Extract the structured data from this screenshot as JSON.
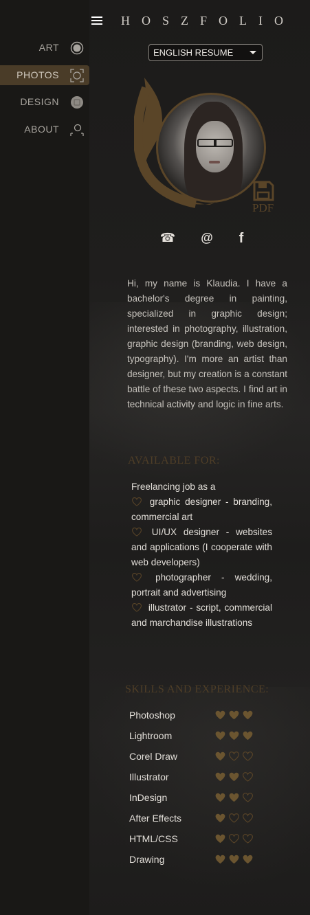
{
  "brand": "HOSZFOLIO",
  "nav": [
    {
      "label": "ART",
      "icon": "art-circle-icon",
      "active": false
    },
    {
      "label": "PHOTOS",
      "icon": "camera-focus-icon",
      "active": true
    },
    {
      "label": "DESIGN",
      "icon": "design-icon",
      "active": false
    },
    {
      "label": "ABOUT",
      "icon": "person-icon",
      "active": false
    }
  ],
  "language_select": {
    "value": "ENGLISH RESUME"
  },
  "pdf": {
    "label": "PDF",
    "icon": "save-icon"
  },
  "contacts": {
    "phone": "☎",
    "email": "@",
    "facebook": "f"
  },
  "bio": "Hi, my name is Klaudia. I have a bachelor's degree in painting, specialized in graphic design; interested in photography, illustration, graphic design (branding, web design, typography). I'm more an artist than designer, but my creation is a constant battle of these two aspects. I find art in technical activity and logic in fine arts.",
  "available": {
    "heading": "AVAILABLE FOR:",
    "intro": "Freelancing  job as a",
    "items": [
      "graphic designer -  branding, commercial art",
      "UI/UX designer - websites and applications (I cooperate with web developers)",
      "photographer - wedding, portrait and advertising",
      "illustrator - script, commercial and marchandise illustrations"
    ]
  },
  "skills": {
    "heading": "SKILLS AND EXPERIENCE:",
    "items": [
      {
        "name": "Photoshop",
        "level": 3
      },
      {
        "name": "Lightroom",
        "level": 3
      },
      {
        "name": "Corel Draw",
        "level": 1
      },
      {
        "name": "Illustrator",
        "level": 2
      },
      {
        "name": "InDesign",
        "level": 2
      },
      {
        "name": "After Effects",
        "level": 1
      },
      {
        "name": "HTML/CSS",
        "level": 1
      },
      {
        "name": "Drawing",
        "level": 3
      }
    ],
    "max_level": 3
  },
  "colors": {
    "accent": "#5a4528",
    "heart": "#6b5530"
  }
}
